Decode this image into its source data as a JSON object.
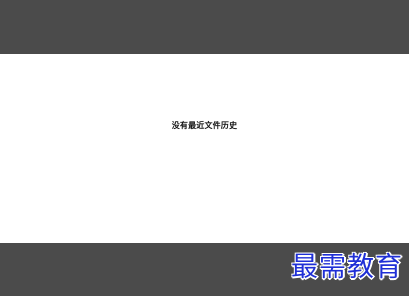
{
  "recent_files": {
    "empty_message": "没有最近文件历史"
  },
  "watermark": {
    "text": "最需教育",
    "color": "#1f2fd6"
  },
  "colors": {
    "bar_background": "#4b4b4b",
    "content_background": "#ffffff"
  }
}
